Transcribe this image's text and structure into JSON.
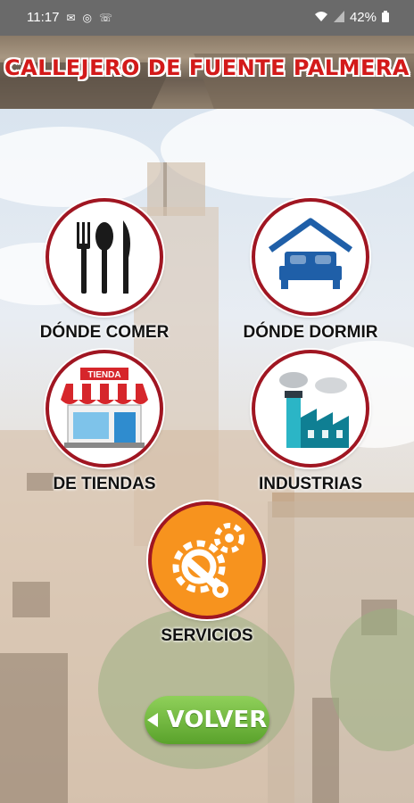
{
  "status_bar": {
    "time": "11:17",
    "battery": "42%"
  },
  "header": {
    "title": "CALLEJERO DE FUENTE PALMERA"
  },
  "menu": {
    "comer": "DÓNDE COMER",
    "dormir": "DÓNDE DORMIR",
    "tiendas": "DE TIENDAS",
    "industrias": "INDUSTRIAS",
    "servicios": "SERVICIOS",
    "tienda_sign": "TIENDA"
  },
  "volver": "VOLVER",
  "colors": {
    "accent_red": "#a01622",
    "volver_green": "#5aa22b",
    "servicios_orange": "#f7931e"
  }
}
